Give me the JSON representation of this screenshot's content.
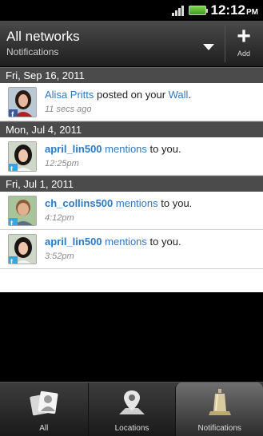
{
  "status_bar": {
    "time": "12:12",
    "ampm": "PM"
  },
  "header": {
    "title": "All networks",
    "subtitle": "Notifications",
    "add_label": "Add"
  },
  "sections": [
    {
      "date": "Fri, Sep 16, 2011",
      "items": [
        {
          "actor": "Alisa Pritts",
          "verb": " posted on your ",
          "target": "Wall",
          "suffix": ".",
          "time": "11 secs ago"
        }
      ]
    },
    {
      "date": "Mon, Jul 4, 2011",
      "items": [
        {
          "actor": "april_lin500",
          "verb": " mentions",
          "target": "",
          "suffix": " to you.",
          "time": "12:25pm"
        }
      ]
    },
    {
      "date": "Fri, Jul 1, 2011",
      "items": [
        {
          "actor": "ch_collins500",
          "verb": " mentions",
          "target": "",
          "suffix": " to you.",
          "time": "4:12pm"
        },
        {
          "actor": "april_lin500",
          "verb": " mentions",
          "target": "",
          "suffix": " to you.",
          "time": "3:52pm"
        }
      ]
    }
  ],
  "tabs": [
    {
      "label": "All",
      "icon": "people-icon"
    },
    {
      "label": "Locations",
      "icon": "location-pin-icon"
    },
    {
      "label": "Notifications",
      "icon": "bell-icon"
    }
  ]
}
